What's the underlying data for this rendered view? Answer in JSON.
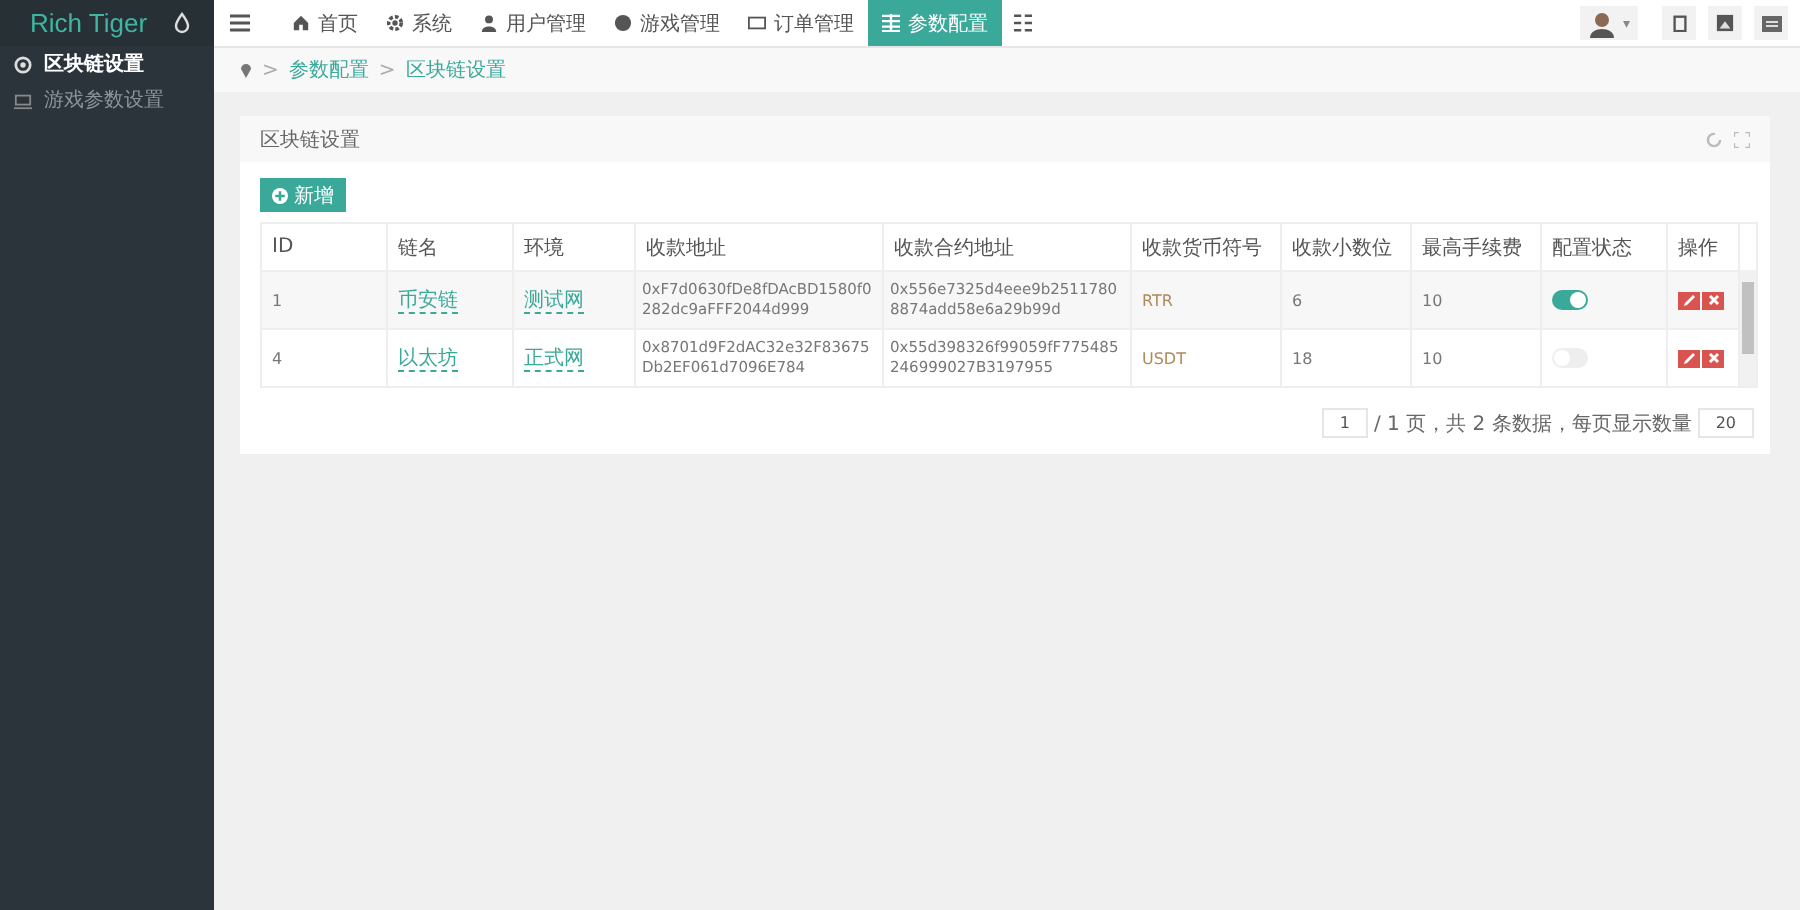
{
  "brand": {
    "title": "Rich Tiger"
  },
  "nav": [
    {
      "label": "首页",
      "selected": false
    },
    {
      "label": "系统",
      "selected": false
    },
    {
      "label": "用户管理",
      "selected": false
    },
    {
      "label": "游戏管理",
      "selected": false
    },
    {
      "label": "订单管理",
      "selected": false
    },
    {
      "label": "参数配置",
      "selected": true
    }
  ],
  "user_menu": {
    "caret": "▾"
  },
  "sidebar": {
    "items": [
      {
        "label": "区块链设置",
        "selected": true
      },
      {
        "label": "游戏参数设置",
        "selected": false
      }
    ]
  },
  "breadcrumb": {
    "separator": ">",
    "items": [
      "参数配置",
      "区块链设置"
    ]
  },
  "panel": {
    "title": "区块链设置",
    "add_button": "新增"
  },
  "table": {
    "columns": [
      "ID",
      "链名",
      "环境",
      "收款地址",
      "收款合约地址",
      "收款货币符号",
      "收款小数位",
      "最高手续费",
      "配置状态",
      "操作"
    ],
    "rows": [
      {
        "id": "1",
        "chain": "币安链",
        "env": "测试网",
        "address": "0xF7d0630fDe8fDAcBD1580f0282dc9aFFF2044d999",
        "contract": "0x556e7325d4eee9b25117808874add58e6a29b99d",
        "symbol": "RTR",
        "decimals": "6",
        "max_fee": "10",
        "on": true
      },
      {
        "id": "4",
        "chain": "以太坊",
        "env": "正式网",
        "address": "0x8701d9F2dAC32e32F83675Db2EF061d7096E784",
        "contract": "0x55d398326f99059fF775485246999027B3197955",
        "symbol": "USDT",
        "decimals": "18",
        "max_fee": "10",
        "on": false
      }
    ]
  },
  "pagination": {
    "page": "1",
    "summary": "/ 1 页，共 2 条数据，每页显示数量",
    "page_size": "20"
  }
}
